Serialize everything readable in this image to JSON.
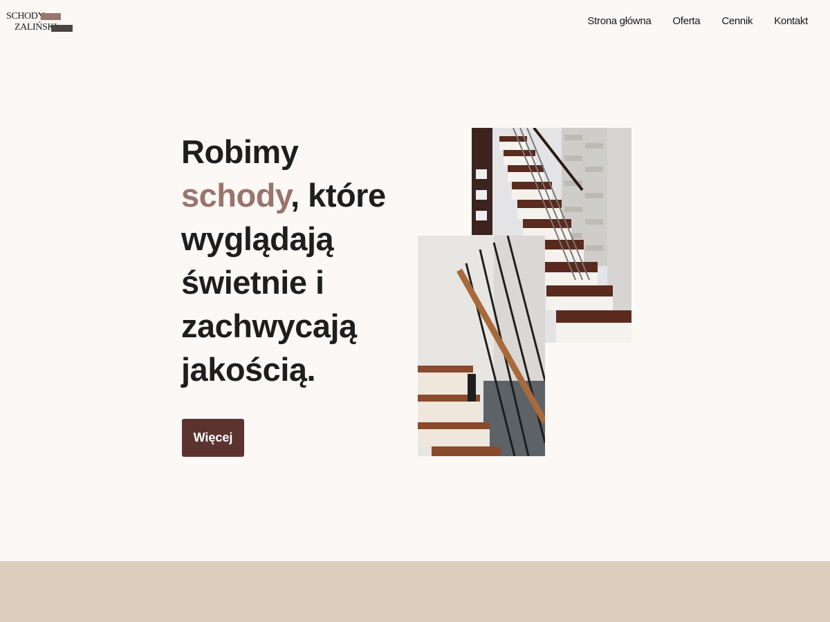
{
  "logo": {
    "line1": "SCHODY",
    "line2": "ZALIŃSKI"
  },
  "nav": {
    "items": [
      {
        "label": "Strona główna"
      },
      {
        "label": "Oferta"
      },
      {
        "label": "Cennik"
      },
      {
        "label": "Kontakt"
      }
    ]
  },
  "hero": {
    "headline_pre": "Robimy ",
    "headline_accent": "schody",
    "headline_post": ", które wyglądają świetnie i zachwycają jakością.",
    "cta_label": "Więcej"
  },
  "colors": {
    "background": "#fbf8f6",
    "accent": "#99746d",
    "button": "#5d3330",
    "band": "#ddcdbd"
  }
}
